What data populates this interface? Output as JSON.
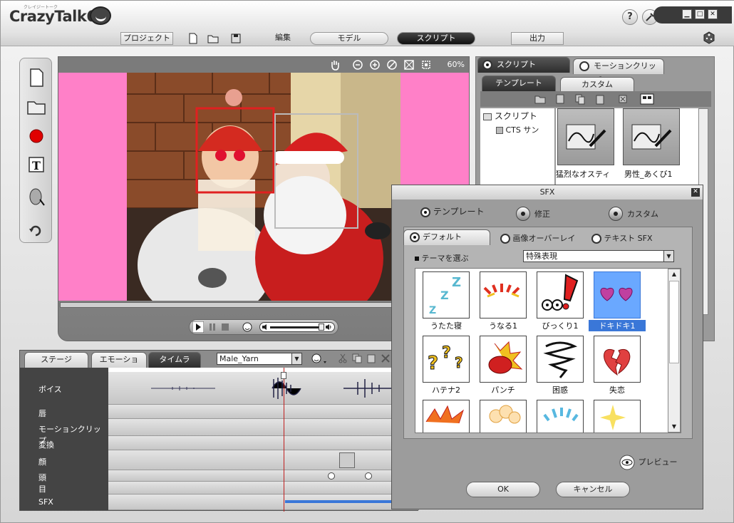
{
  "app": {
    "title": "CrazyTalk6",
    "sub": "クレイジートーク"
  },
  "window": {
    "help": "?",
    "min": "▁",
    "max": "□",
    "close": "✕"
  },
  "menu": {
    "project": "プロジェクト",
    "edit": "編集",
    "model": "モデル",
    "script": "スクリプト",
    "output": "出力"
  },
  "stage": {
    "zoom": "60%"
  },
  "right": {
    "tab_script": "スクリプト",
    "tab_motion": "モーションクリップ",
    "sub_template": "テンプレート",
    "sub_custom": "カスタム",
    "tree": {
      "root": "スクリプト",
      "child": "CTS サン"
    },
    "templates": [
      {
        "label": "猛烈なオスティ"
      },
      {
        "label": "男性_あくび1"
      }
    ]
  },
  "timeline": {
    "tabs": [
      "ステージ",
      "エモーション",
      "タイムライン"
    ],
    "voice_select": "Male_Yarn",
    "rows": [
      "ボイス",
      "唇",
      "モーションクリップ",
      "変換",
      "顔",
      "頭",
      "目",
      "SFX"
    ]
  },
  "dialog": {
    "title": "SFX",
    "opt_template": "テンプレート",
    "opt_modify": "修正",
    "opt_custom": "カスタム",
    "tab_default": "デフォルト",
    "tab_overlay": "画像オーバーレイ",
    "tab_text": "テキスト SFX",
    "theme_label": "テーマを選ぶ",
    "theme_value": "特殊表現",
    "items": [
      {
        "label": "うたた寝"
      },
      {
        "label": "うなる1"
      },
      {
        "label": "びっくり1"
      },
      {
        "label": "ドキドキ1"
      },
      {
        "label": "ハテナ2"
      },
      {
        "label": "パンチ"
      },
      {
        "label": "困惑"
      },
      {
        "label": "失恋"
      }
    ],
    "preview": "プレビュー",
    "ok": "OK",
    "cancel": "キャンセル"
  },
  "colors": {
    "accent": "#3a77d8",
    "stage_bg": "#ff80c8",
    "face_box": "#e02020"
  }
}
